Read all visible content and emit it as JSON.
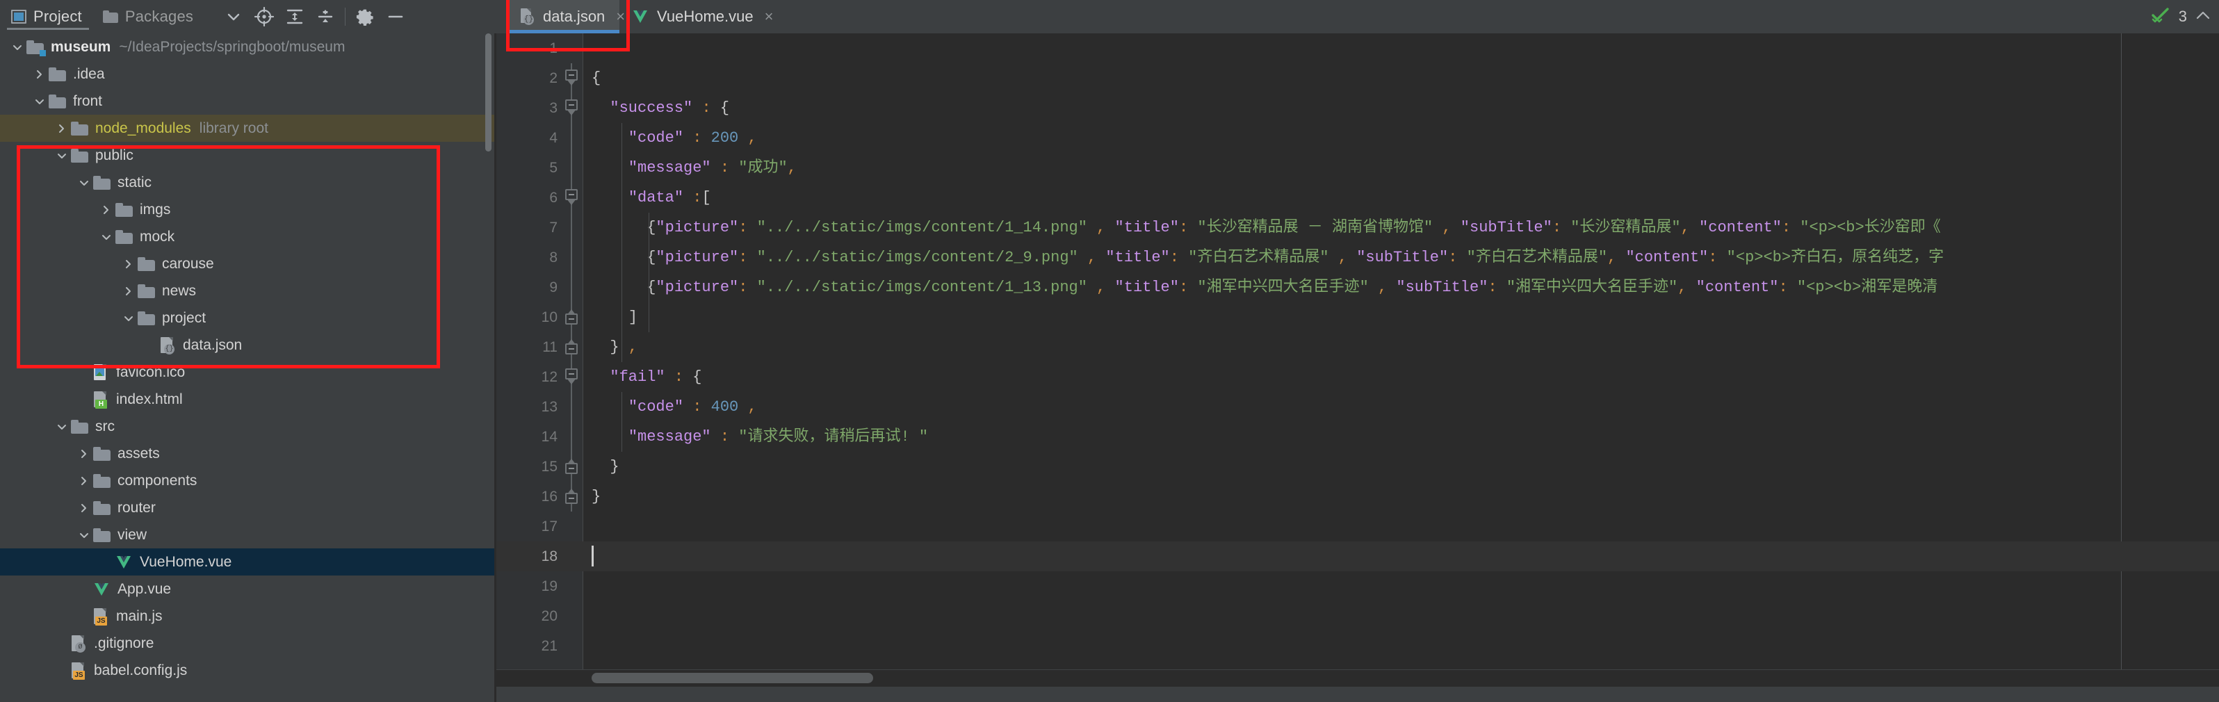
{
  "tool_window": {
    "tabs": [
      {
        "label": "Project",
        "icon": "project-icon",
        "active": true
      },
      {
        "label": "Packages",
        "icon": "packages-icon",
        "active": false
      }
    ],
    "actions": [
      {
        "name": "chevron-down-icon"
      },
      {
        "name": "locate-target-icon"
      },
      {
        "name": "expand-all-icon"
      },
      {
        "name": "collapse-all-icon"
      },
      {
        "name": "gear-icon"
      },
      {
        "name": "minimize-icon"
      }
    ]
  },
  "editor_tabs": [
    {
      "label": "data.json",
      "icon": "json-file-icon",
      "active": true,
      "close": "×"
    },
    {
      "label": "VueHome.vue",
      "icon": "vue-file-icon",
      "active": false,
      "close": "×"
    }
  ],
  "status": {
    "inspection_icon": "double-check-icon",
    "inspection_count": "3",
    "collapse_caret": "⌃"
  },
  "tree": [
    {
      "indent": 0,
      "arrow": "down",
      "icon": "module-folder",
      "label": "museum",
      "bold": true,
      "suffix": "~/IdeaProjects/springboot/museum",
      "selected": false
    },
    {
      "indent": 1,
      "arrow": "right",
      "icon": "folder",
      "label": ".idea",
      "selected": false
    },
    {
      "indent": 1,
      "arrow": "down",
      "icon": "folder",
      "label": "front",
      "selected": false
    },
    {
      "indent": 2,
      "arrow": "right",
      "icon": "folder",
      "label": "node_modules",
      "labelColor": "yellow",
      "suffix": "library root",
      "highlight": true
    },
    {
      "indent": 2,
      "arrow": "down",
      "icon": "folder",
      "label": "public",
      "selected": false
    },
    {
      "indent": 3,
      "arrow": "down",
      "icon": "folder",
      "label": "static",
      "selected": false
    },
    {
      "indent": 4,
      "arrow": "right",
      "icon": "folder",
      "label": "imgs",
      "selected": false
    },
    {
      "indent": 4,
      "arrow": "down",
      "icon": "folder",
      "label": "mock",
      "selected": false
    },
    {
      "indent": 5,
      "arrow": "right",
      "icon": "folder",
      "label": "carouse",
      "selected": false
    },
    {
      "indent": 5,
      "arrow": "right",
      "icon": "folder",
      "label": "news",
      "selected": false
    },
    {
      "indent": 5,
      "arrow": "down",
      "icon": "folder",
      "label": "project",
      "selected": false
    },
    {
      "indent": 6,
      "arrow": "none",
      "icon": "json-file",
      "label": "data.json",
      "selected": false
    },
    {
      "indent": 3,
      "arrow": "none",
      "icon": "image-file",
      "label": "favicon.ico",
      "selected": false
    },
    {
      "indent": 3,
      "arrow": "none",
      "icon": "html-file",
      "label": "index.html",
      "selected": false
    },
    {
      "indent": 2,
      "arrow": "down",
      "icon": "folder",
      "label": "src",
      "selected": false
    },
    {
      "indent": 3,
      "arrow": "right",
      "icon": "folder",
      "label": "assets",
      "selected": false
    },
    {
      "indent": 3,
      "arrow": "right",
      "icon": "folder",
      "label": "components",
      "selected": false
    },
    {
      "indent": 3,
      "arrow": "right",
      "icon": "folder",
      "label": "router",
      "selected": false
    },
    {
      "indent": 3,
      "arrow": "down",
      "icon": "folder",
      "label": "view",
      "selected": false
    },
    {
      "indent": 4,
      "arrow": "none",
      "icon": "vue-file",
      "label": "VueHome.vue",
      "selected": true
    },
    {
      "indent": 3,
      "arrow": "none",
      "icon": "vue-file",
      "label": "App.vue",
      "selected": false
    },
    {
      "indent": 3,
      "arrow": "none",
      "icon": "js-file",
      "label": "main.js",
      "selected": false
    },
    {
      "indent": 2,
      "arrow": "none",
      "icon": "git-file",
      "label": ".gitignore",
      "selected": false
    },
    {
      "indent": 2,
      "arrow": "none",
      "icon": "js-file",
      "label": "babel.config.js",
      "selected": false
    }
  ],
  "code": {
    "language": "json",
    "filename": "data.json",
    "current_line": 18,
    "total_lines": 21,
    "lines": [
      {
        "n": 1,
        "fold": "none",
        "text": ""
      },
      {
        "n": 2,
        "fold": "minus-down",
        "text": "{"
      },
      {
        "n": 3,
        "fold": "minus-down",
        "text": "  \"success\" : {"
      },
      {
        "n": 4,
        "fold": "line",
        "text": "    \"code\" : 200 ,"
      },
      {
        "n": 5,
        "fold": "line",
        "text": "    \"message\" : \"成功\","
      },
      {
        "n": 6,
        "fold": "minus-down",
        "text": "    \"data\" :["
      },
      {
        "n": 7,
        "fold": "line",
        "text": "      {\"picture\": \"../../static/imgs/content/1_14.png\" , \"title\": \"长沙窑精品展 － 湖南省博物馆\" , \"subTitle\": \"长沙窑精品展\", \"content\": \"<p><b>长沙窑即《"
      },
      {
        "n": 8,
        "fold": "line",
        "text": "      {\"picture\": \"../../static/imgs/content/2_9.png\" , \"title\": \"齐白石艺术精品展\" , \"subTitle\": \"齐白石艺术精品展\", \"content\": \"<p><b>齐白石，原名纯芝，字"
      },
      {
        "n": 9,
        "fold": "line",
        "text": "      {\"picture\": \"../../static/imgs/content/1_13.png\" , \"title\": \"湘军中兴四大名臣手迹\" , \"subTitle\": \"湘军中兴四大名臣手迹\", \"content\": \"<p><b>湘军是晚清"
      },
      {
        "n": 10,
        "fold": "minus-up",
        "text": "    ]"
      },
      {
        "n": 11,
        "fold": "minus-up",
        "text": "  } ,"
      },
      {
        "n": 12,
        "fold": "minus-down",
        "text": "  \"fail\" : {"
      },
      {
        "n": 13,
        "fold": "line",
        "text": "    \"code\" : 400 ,"
      },
      {
        "n": 14,
        "fold": "line",
        "text": "    \"message\" : \"请求失败，请稍后再试! \""
      },
      {
        "n": 15,
        "fold": "minus-up",
        "text": "  }"
      },
      {
        "n": 16,
        "fold": "minus-up",
        "text": "}"
      },
      {
        "n": 17,
        "fold": "none",
        "text": ""
      },
      {
        "n": 18,
        "fold": "none",
        "text": ""
      },
      {
        "n": 19,
        "fold": "none",
        "text": ""
      },
      {
        "n": 20,
        "fold": "none",
        "text": ""
      },
      {
        "n": 21,
        "fold": "none",
        "text": ""
      }
    ]
  },
  "colors": {
    "editor_bg": "#2b2b2b",
    "gutter_bg": "#313335",
    "panel_bg": "#3c3f41",
    "selection_blue": "#0d293e",
    "tab_active_underline": "#4a88c7",
    "string_green": "#7fa86a",
    "key_purple": "#c792ea",
    "number_blue": "#6897bb",
    "punct_orange": "#cf8e45",
    "highlight_row": "#4f4a33",
    "annotation_red": "#ff1a1a",
    "inspection_green": "#4caf50"
  },
  "annotations": [
    {
      "name": "tree-highlight-box"
    },
    {
      "name": "tab-highlight-box"
    }
  ]
}
